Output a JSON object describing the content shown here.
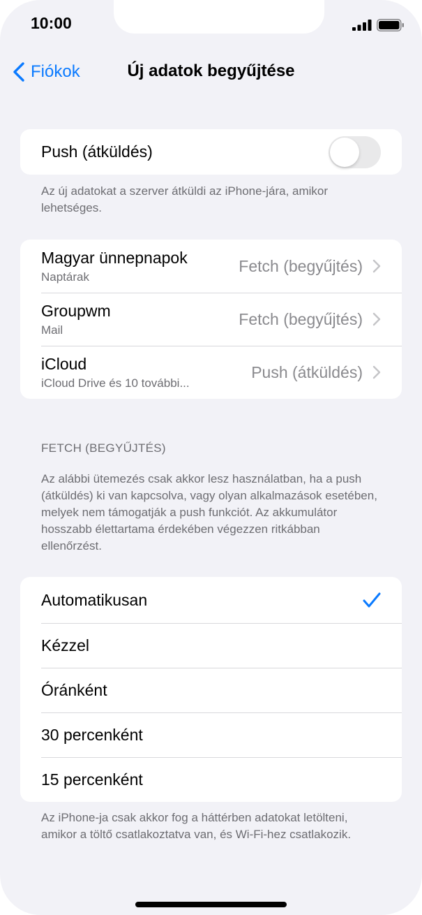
{
  "status_bar": {
    "time": "10:00"
  },
  "nav": {
    "back_label": "Fiókok",
    "title": "Új adatok begyűjtése"
  },
  "push": {
    "label": "Push (átküldés)",
    "enabled": false,
    "footnote": "Az új adatokat a szerver átküldi az iPhone-jára, amikor lehetséges."
  },
  "accounts": [
    {
      "name": "Magyar ünnepnapok",
      "detail": "Naptárak",
      "mode": "Fetch (begyűjtés)"
    },
    {
      "name": "Groupwm",
      "detail": "Mail",
      "mode": "Fetch (begyűjtés)"
    },
    {
      "name": "iCloud",
      "detail": "iCloud Drive és 10 további...",
      "mode": "Push (átküldés)"
    }
  ],
  "fetch": {
    "header": "FETCH (BEGYŰJTÉS)",
    "description": "Az alábbi ütemezés csak akkor lesz használatban, ha a push (átküldés) ki van kapcsolva, vagy olyan alkalmazások esetében, melyek nem támogatják a push funkciót. Az akkumulátor hosszabb élettartama érdekében végezzen ritkábban ellenőrzést.",
    "options": [
      "Automatikusan",
      "Kézzel",
      "Óránként",
      "30 percenként",
      "15 percenként"
    ],
    "selected": "Automatikusan",
    "footnote": "Az iPhone-ja csak akkor fog a háttérben adatokat letölteni, amikor a töltő csatlakoztatva van, és Wi-Fi-hez csatlakozik."
  },
  "colors": {
    "accent": "#0a7aff",
    "background": "#f2f2f7",
    "toggle_off": "#e9e9ea"
  }
}
